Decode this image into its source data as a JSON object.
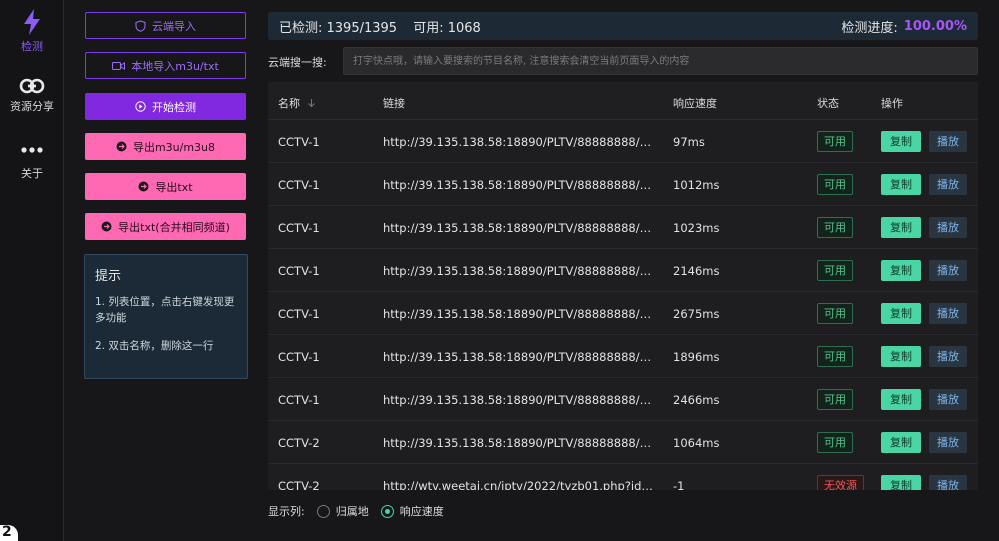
{
  "nav": {
    "items": [
      {
        "label": "检测",
        "icon": "lightning-icon"
      },
      {
        "label": "资源分享",
        "icon": "link-icon"
      },
      {
        "label": "关于",
        "icon": "more-dots-icon"
      }
    ],
    "corner_glyph": "2"
  },
  "actions": {
    "cloud_import": "云端导入",
    "local_import": "本地导入m3u/txt",
    "start_check": "开始检测",
    "export_m3u": "导出m3u/m3u8",
    "export_txt": "导出txt",
    "export_txt_merge": "导出txt(合并相同频道)"
  },
  "tips": {
    "title": "提示",
    "lines": [
      "1. 列表位置，点击右键发现更多功能",
      "2. 双击名称，删除这一行"
    ]
  },
  "status": {
    "detected": "已检测: 1395/1395",
    "available": "可用: 1068",
    "progress_label": "检测进度:",
    "progress_value": "100.00%"
  },
  "search": {
    "label": "云端搜一搜:",
    "placeholder": "打字快点哦，请输入要搜索的节目名称, 注意搜索会清空当前页面导入的内容"
  },
  "table": {
    "headers": {
      "name": "名称",
      "link": "链接",
      "speed": "响应速度",
      "status": "状态",
      "ops": "操作"
    },
    "copy_label": "复制",
    "play_label": "播放",
    "rows": [
      {
        "name": "CCTV-1",
        "link": "http://39.135.138.58:18890/PLTV/88888888/224...",
        "speed": "97ms",
        "status": "可用",
        "ok": true
      },
      {
        "name": "CCTV-1",
        "link": "http://39.135.138.58:18890/PLTV/88888888/224...",
        "speed": "1012ms",
        "status": "可用",
        "ok": true
      },
      {
        "name": "CCTV-1",
        "link": "http://39.135.138.58:18890/PLTV/88888888/224...",
        "speed": "1023ms",
        "status": "可用",
        "ok": true
      },
      {
        "name": "CCTV-1",
        "link": "http://39.135.138.58:18890/PLTV/88888888/224...",
        "speed": "2146ms",
        "status": "可用",
        "ok": true
      },
      {
        "name": "CCTV-1",
        "link": "http://39.135.138.58:18890/PLTV/88888888/224...",
        "speed": "2675ms",
        "status": "可用",
        "ok": true
      },
      {
        "name": "CCTV-1",
        "link": "http://39.135.138.58:18890/PLTV/88888888/224...",
        "speed": "1896ms",
        "status": "可用",
        "ok": true
      },
      {
        "name": "CCTV-1",
        "link": "http://39.135.138.58:18890/PLTV/88888888/224...",
        "speed": "2466ms",
        "status": "可用",
        "ok": true
      },
      {
        "name": "CCTV-2",
        "link": "http://39.135.138.58:18890/PLTV/88888888/224...",
        "speed": "1064ms",
        "status": "可用",
        "ok": true
      },
      {
        "name": "CCTV-2",
        "link": "http://wtv.weetai.cn/iptv/2022/tyzb01.php?id=c...",
        "speed": "-1",
        "status": "无效源",
        "ok": false
      }
    ]
  },
  "display": {
    "label": "显示列:",
    "options": [
      {
        "label": "归属地",
        "selected": false
      },
      {
        "label": "响应速度",
        "selected": true
      }
    ]
  },
  "colors": {
    "accent": "#8b5cf6",
    "pink": "#ff69b4",
    "ok": "#4ad6a4",
    "bad": "#ef5a5a"
  }
}
